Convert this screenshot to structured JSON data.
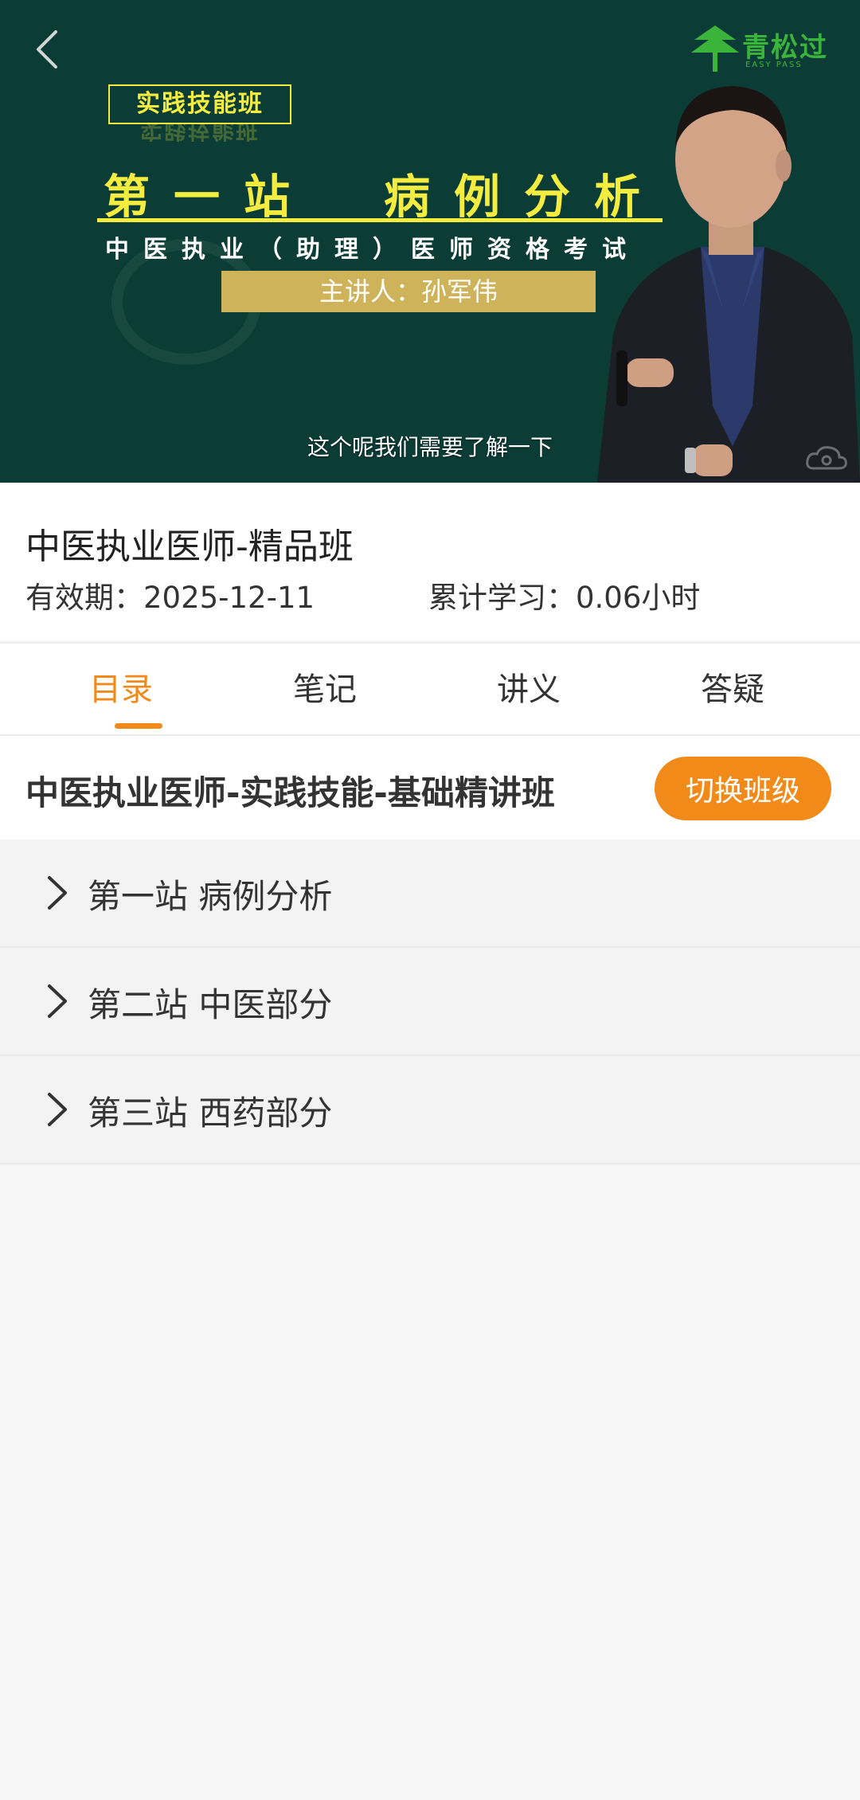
{
  "video": {
    "logo_text": "青松过",
    "logo_subtext": "EASY PASS",
    "class_tag": "实践技能班",
    "station_title": "第一站　病例分析",
    "exam_subtitle": "中医执业（助理）医师资格考试",
    "lecturer": "主讲人：孙军伟",
    "caption": "这个呢我们需要了解一下"
  },
  "course": {
    "title": "中医执业医师-精品班",
    "validity": "有效期：2025-12-11",
    "study_time": "累计学习：0.06小时"
  },
  "tabs": [
    {
      "label": "目录",
      "active": true
    },
    {
      "label": "笔记",
      "active": false
    },
    {
      "label": "讲义",
      "active": false
    },
    {
      "label": "答疑",
      "active": false
    }
  ],
  "class_header": {
    "name": "中医执业医师-实践技能-基础精讲班",
    "switch_label": "切换班级"
  },
  "chapters": [
    {
      "label": "第一站 病例分析"
    },
    {
      "label": "第二站 中医部分"
    },
    {
      "label": "第三站 西药部分"
    }
  ],
  "colors": {
    "accent": "#f28a1a",
    "video_bg": "#0b3d36",
    "title_yellow": "#f4ec3f",
    "logo_green": "#3bb43c"
  }
}
